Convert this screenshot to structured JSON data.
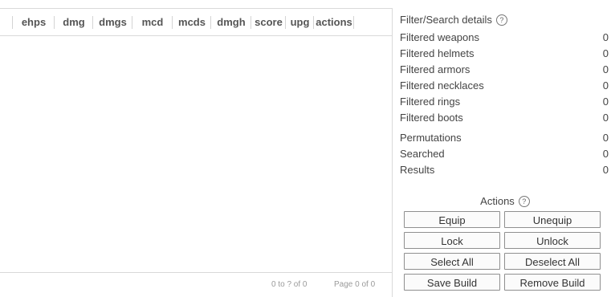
{
  "grid": {
    "columns": [
      "ehps",
      "dmg",
      "dmgs",
      "mcd",
      "mcds",
      "dmgh",
      "score",
      "upg",
      "actions"
    ],
    "footer": {
      "range": "0 to ? of 0",
      "page": "Page 0 of 0"
    }
  },
  "panel": {
    "title": "Filter/Search details",
    "help_glyph": "?",
    "filtered": [
      {
        "label": "Filtered weapons",
        "value": "0"
      },
      {
        "label": "Filtered helmets",
        "value": "0"
      },
      {
        "label": "Filtered armors",
        "value": "0"
      },
      {
        "label": "Filtered necklaces",
        "value": "0"
      },
      {
        "label": "Filtered rings",
        "value": "0"
      },
      {
        "label": "Filtered boots",
        "value": "0"
      }
    ],
    "search": [
      {
        "label": "Permutations",
        "value": "0"
      },
      {
        "label": "Searched",
        "value": "0"
      },
      {
        "label": "Results",
        "value": "0"
      }
    ]
  },
  "actions": {
    "title": "Actions",
    "equip": "Equip",
    "unequip": "Unequip",
    "lock": "Lock",
    "unlock": "Unlock",
    "select_all": "Select All",
    "deselect_all": "Deselect All",
    "save_build": "Save Build",
    "remove_build": "Remove Build"
  }
}
